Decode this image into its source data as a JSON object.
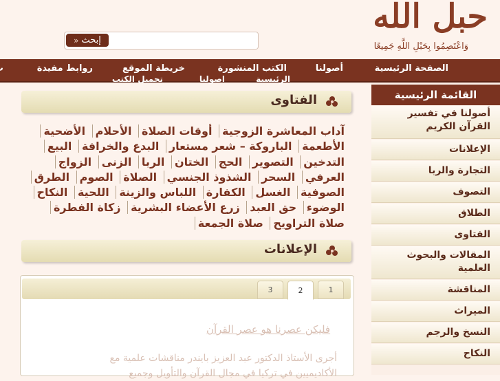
{
  "header": {
    "logo_title": "حبل الله",
    "logo_subtitle": "وَاعْتَصِمُوا بِحَبْلِ اللَّهِ جَمِيعًا",
    "search_button": "إبحث",
    "search_placeholder": ""
  },
  "topnav": {
    "items": [
      "الصفحة الرئيسية",
      "أصولنا",
      "الكتب المنشورة",
      "خريطة الموقع",
      "روابط مفيدة",
      "ت"
    ],
    "row2": [
      "الرئيسية",
      "أصولنا",
      "تحميل الكتب"
    ]
  },
  "sidebar": {
    "title": "القائمة الرئيسية",
    "items": [
      [
        "أصولنا في تفسير",
        "القرآن الكريم"
      ],
      [
        "الإعلانات"
      ],
      [
        "التجارة والربا"
      ],
      [
        "التصوف"
      ],
      [
        "الطلاق"
      ],
      [
        "الفتاوى"
      ],
      [
        "المقالات والبحوث",
        "العلمية"
      ],
      [
        "المناقشة"
      ],
      [
        "الميراث"
      ],
      [
        "النسخ والرجم"
      ],
      [
        "النكاح"
      ]
    ]
  },
  "fatawa": {
    "title": "الفتاوى",
    "topics": [
      "آداب المعاشرة الزوجية",
      "أوقات الصلاة",
      "الأحلام",
      "الأضحية",
      "الأطعمة",
      "الباروكة – شعر مستعار",
      "البدع والخرافة",
      "البيع",
      "التدخين",
      "التصوير",
      "الحج",
      "الختان",
      "الربا",
      "الزنى",
      "الزواج",
      "العرفي",
      "السحر",
      "الشذوذ الجنسي",
      "الصلاة",
      "الصوم",
      "الطرق",
      "الصوفية",
      "الغسل",
      "الكفارة",
      "اللباس والزينة",
      "اللحية",
      "النكاح",
      "الوضوء",
      "حق العبد",
      "زرع الأعضاء البشرية",
      "زكاة الفطرة",
      "صلاة التراويح",
      "صلاة الجمعة"
    ]
  },
  "ads": {
    "title": "الإعلانات",
    "tabs": [
      "1",
      "2",
      "3"
    ],
    "active_tab": "2",
    "ad_title": "فليكن عصرنا هو عصر القرآن",
    "ad_text_1": "أجرى الأستاذ الدكتور عبد العزيز بايندر مناقشات علمية مع",
    "ad_text_2": "الأكاديميين في تركيا في مجال القرآن والتأويل وجميع"
  },
  "colors": {
    "brand": "#7a3320",
    "background": "#fdf3ed",
    "panel": "#efe7cf"
  }
}
